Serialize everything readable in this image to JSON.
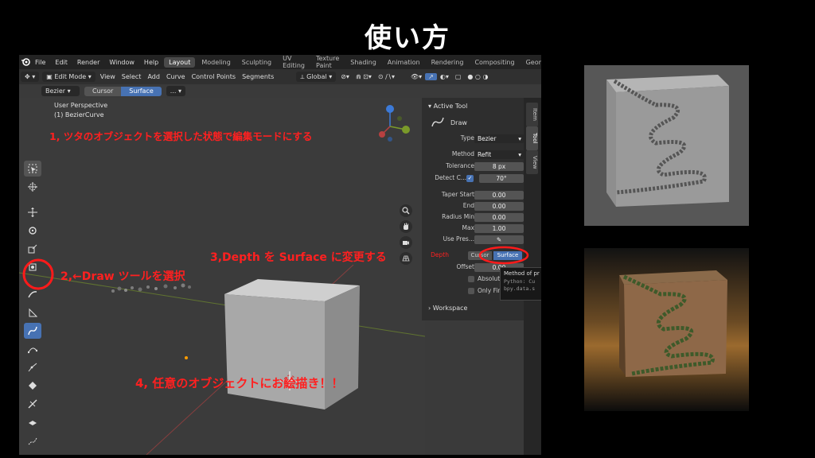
{
  "slide": {
    "title": "使い方"
  },
  "menubar": {
    "menus": [
      "File",
      "Edit",
      "Render",
      "Window",
      "Help"
    ],
    "workspaces": [
      "Layout",
      "Modeling",
      "Sculpting",
      "UV Editing",
      "Texture Paint",
      "Shading",
      "Animation",
      "Rendering",
      "Compositing",
      "Geometr"
    ],
    "active_workspace": "Layout"
  },
  "header": {
    "mode": "Edit Mode",
    "menus": [
      "View",
      "Select",
      "Add",
      "Curve",
      "Control Points",
      "Segments"
    ],
    "orientation": "Global"
  },
  "tool_header": {
    "curve_type": "Bezier",
    "depth_options": [
      "Cursor",
      "Surface"
    ],
    "selected": "Surface",
    "more": "..."
  },
  "viewport": {
    "perspective": "User Perspective",
    "object": "(1) BezierCurve"
  },
  "active_tool": {
    "title": "Active Tool",
    "tool_name": "Draw",
    "rows": [
      {
        "label": "Type",
        "value": "Bezier"
      },
      {
        "label": "Method",
        "value": "Refit"
      },
      {
        "label": "Tolerance",
        "value": "8 px"
      },
      {
        "label": "Detect C...",
        "value": "70°"
      },
      {
        "label": "Taper Start",
        "value": "0.00"
      },
      {
        "label": "End",
        "value": "0.00"
      },
      {
        "label": "Radius Min",
        "value": "0.00"
      },
      {
        "label": "Max",
        "value": "1.00"
      },
      {
        "label": "Use Pres...",
        "value": ""
      },
      {
        "label": "Depth",
        "value": ""
      },
      {
        "label": "Offset",
        "value": "0.00"
      }
    ],
    "depth_cursor": "Cursor",
    "depth_surface": "Surface",
    "absolute_label": "Absolute",
    "only_first_label": "Only Fir",
    "workspace_label": "Workspace"
  },
  "ntabs": [
    "Item",
    "Tool",
    "View"
  ],
  "tooltip": {
    "line1": "Method of pr",
    "line2": "Python: Cu",
    "line3": "bpy.data.s"
  },
  "annotations": {
    "step1": "1, ツタのオブジェクトを選択した状態で編集モードにする",
    "step2": "2,←Draw ツールを選択",
    "step3": "3,Depth を Surface に変更する",
    "step4": "4, 任意のオブジェクトにお絵描き！！"
  },
  "colors": {
    "annotation": "#ff2020",
    "selected": "#4772b3",
    "accent_axis_x": "#b84040",
    "accent_axis_y": "#7a9a2a"
  }
}
